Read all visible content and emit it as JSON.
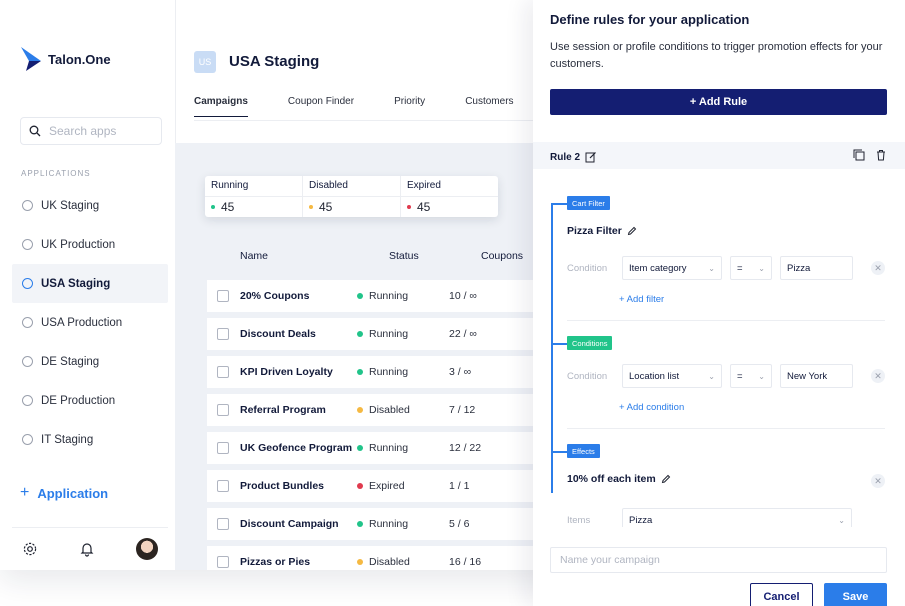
{
  "sidebar": {
    "logo_text": "Talon.One",
    "search_placeholder": "Search apps",
    "section_label": "APPLICATIONS",
    "items": [
      {
        "label": "UK Staging"
      },
      {
        "label": "UK Production"
      },
      {
        "label": "USA Staging",
        "active": true
      },
      {
        "label": "USA Production"
      },
      {
        "label": "DE Staging"
      },
      {
        "label": "DE Production"
      },
      {
        "label": "IT Staging"
      }
    ],
    "add_application_label": "Application"
  },
  "header": {
    "badge": "US",
    "title": "USA Staging",
    "tabs": [
      "Campaigns",
      "Coupon Finder",
      "Priority",
      "Customers"
    ]
  },
  "stats": [
    {
      "label": "Running",
      "value": "45",
      "color": "#21c48a"
    },
    {
      "label": "Disabled",
      "value": "45",
      "color": "#f5b942"
    },
    {
      "label": "Expired",
      "value": "45",
      "color": "#e03a4e"
    }
  ],
  "table": {
    "headers": [
      "Name",
      "Status",
      "Coupons"
    ],
    "rows": [
      {
        "name": "20% Coupons",
        "status": "Running",
        "coupons": "10 / ∞"
      },
      {
        "name": "Discount Deals",
        "status": "Running",
        "coupons": "22 / ∞"
      },
      {
        "name": "KPI Driven Loyalty",
        "status": "Running",
        "coupons": "3 / ∞"
      },
      {
        "name": "Referral Program",
        "status": "Disabled",
        "coupons": "7 / 12"
      },
      {
        "name": "UK Geofence Program",
        "status": "Running",
        "coupons": "12 / 22"
      },
      {
        "name": "Product Bundles",
        "status": "Expired",
        "coupons": "1 / 1"
      },
      {
        "name": "Discount Campaign",
        "status": "Running",
        "coupons": "5 / 6"
      },
      {
        "name": "Pizzas or Pies",
        "status": "Disabled",
        "coupons": "16 / 16"
      }
    ],
    "status_colors": {
      "Running": "#21c48a",
      "Disabled": "#f5b942",
      "Expired": "#e03a4e"
    }
  },
  "panel": {
    "title": "Define rules for your application",
    "description": "Use session or profile conditions to trigger promotion effects for your customers.",
    "add_rule_label": "+ Add Rule",
    "rule_label": "Rule 2",
    "cart_filter": {
      "tag": "Cart Filter",
      "name": "Pizza Filter",
      "condition_label": "Condition",
      "attribute": "Item category",
      "operator": "=",
      "value": "Pizza",
      "add_link": "+ Add filter"
    },
    "conditions": {
      "tag": "Conditions",
      "condition_label": "Condition",
      "attribute": "Location list",
      "operator": "=",
      "value": "New York",
      "add_link": "+ Add condition"
    },
    "effects": {
      "tag": "Effects",
      "name": "10% off each item",
      "items_label": "Items",
      "items_value": "Pizza"
    },
    "campaign_placeholder": "Name your campaign",
    "cancel_label": "Cancel",
    "save_label": "Save"
  }
}
